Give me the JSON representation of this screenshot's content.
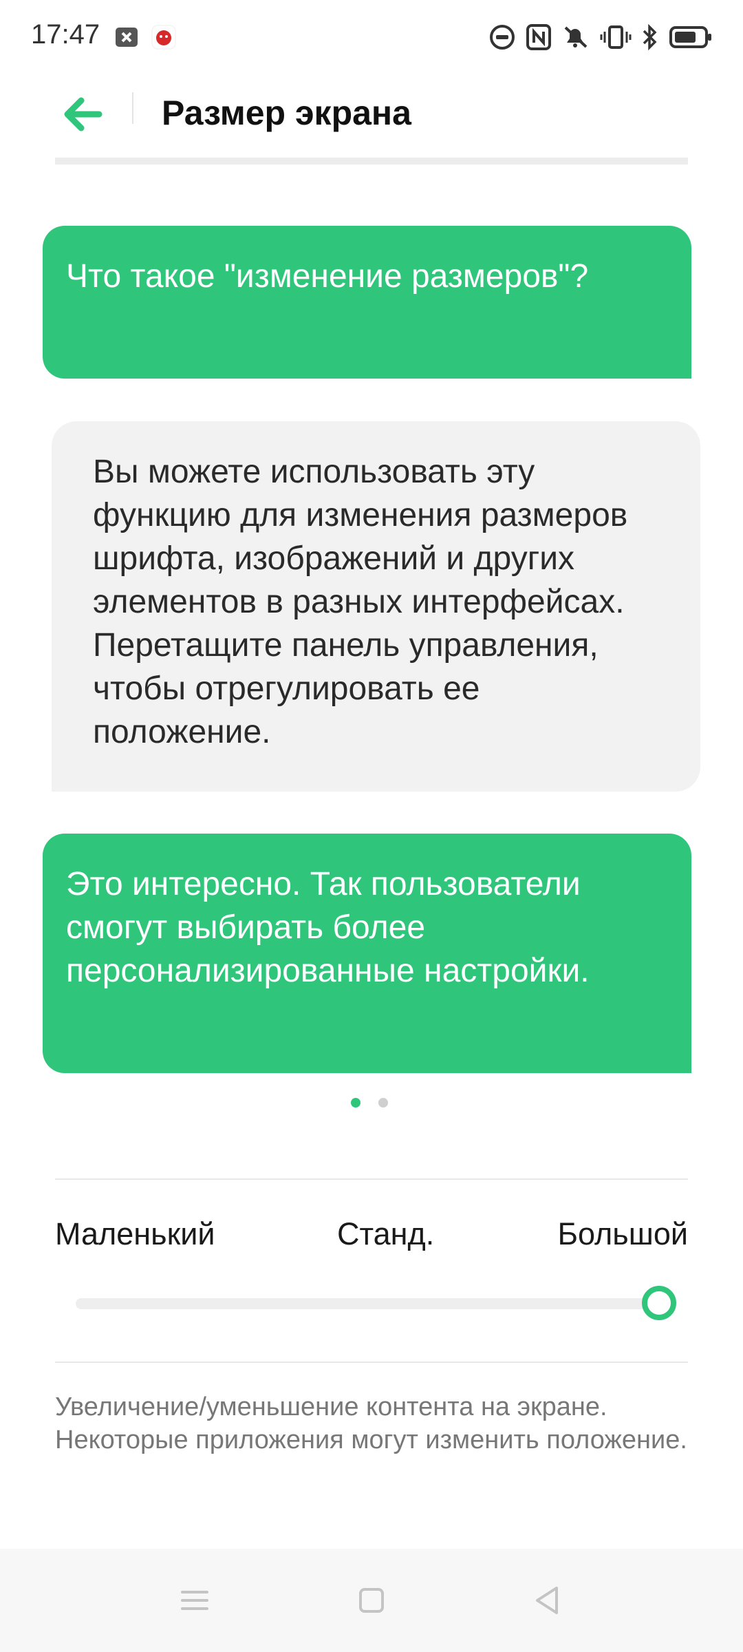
{
  "status_bar": {
    "time": "17:47",
    "notification_icons": [
      "close-box-icon",
      "app-notification-icon"
    ],
    "system_icons": [
      "do-not-disturb-icon",
      "nfc-icon",
      "mute-icon",
      "vibrate-icon",
      "bluetooth-icon",
      "battery-icon"
    ]
  },
  "header": {
    "back_icon": "arrow-left-icon",
    "title": "Размер экрана"
  },
  "chat": {
    "question": "Что такое \"изменение размеров\"?",
    "answer": "Вы можете использовать эту функцию для изменения размеров шрифта, изображений и других элементов в разных интерфейсах. Перетащите панель управления, чтобы отрегулировать ее положение.",
    "reaction": "Это интересно. Так пользователи смогут выбирать более персонализированные настройки."
  },
  "pager": {
    "count": 2,
    "active": 0
  },
  "size_control": {
    "label_small": "Маленький",
    "label_standard": "Станд.",
    "label_large": "Большой",
    "selected": "Большой",
    "slider_value_fraction": 1.0
  },
  "description": "Увеличение/уменьшение контента на экране. Некоторые приложения могут изменить положение.",
  "colors": {
    "accent": "#2fc67c",
    "grey_bubble": "#f2f2f2"
  },
  "nav_bar": {
    "icons": [
      "menu-icon",
      "home-icon",
      "back-triangle-icon"
    ]
  }
}
